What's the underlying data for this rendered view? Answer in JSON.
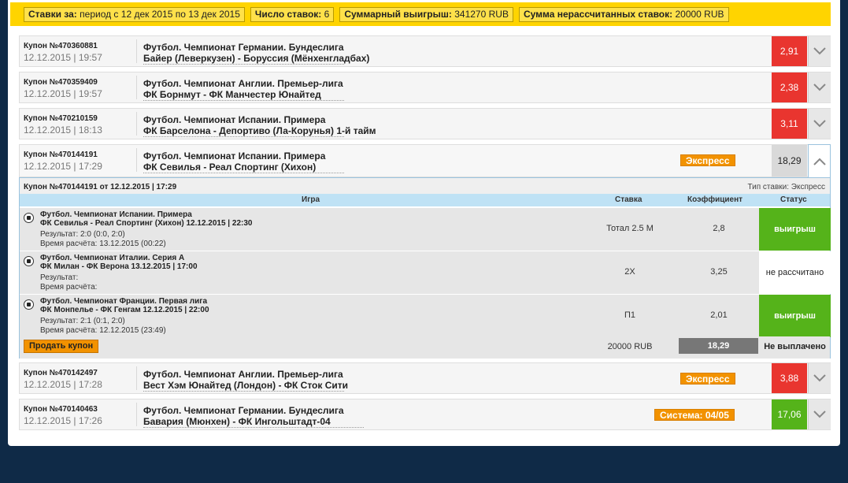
{
  "summary": {
    "period_label": "Ставки за:",
    "period_value": "период с 12 дек 2015 по 13 дек 2015",
    "count_label": "Число ставок:",
    "count_value": "6",
    "total_label": "Суммарный выигрыш:",
    "total_value": "341270 RUB",
    "pending_label": "Сумма нерассчитанных ставок:",
    "pending_value": "20000 RUB"
  },
  "coupons": [
    {
      "number": "Купон №470360881",
      "date": "12.12.2015 | 19:57",
      "league": "Футбол. Чемпионат Германии. Бундеслига",
      "match": "Байер (Леверкузен) - Боруссия (Мёнхенгладбах)",
      "odds": "2,91",
      "badge": ""
    },
    {
      "number": "Купон №470359409",
      "date": "12.12.2015 | 19:57",
      "league": "Футбол. Чемпионат Англии. Премьер-лига",
      "match": "ФК Борнмут - ФК Манчестер Юнайтед",
      "odds": "2,38",
      "badge": ""
    },
    {
      "number": "Купон №470210159",
      "date": "12.12.2015 | 18:13",
      "league": "Футбол. Чемпионат Испании. Примера",
      "match": "ФК Барселона - Депортиво (Ла-Корунья) 1-й тайм",
      "odds": "3,11",
      "badge": ""
    },
    {
      "number": "Купон №470144191",
      "date": "12.12.2015 | 17:29",
      "league": "Футбол. Чемпионат Испании. Примера",
      "match": "ФК Севилья - Реал Спортинг (Хихон)",
      "odds": "18,29",
      "badge": "Экспресс"
    },
    {
      "number": "Купон №470142497",
      "date": "12.12.2015 | 17:28",
      "league": "Футбол. Чемпионат Англии. Премьер-лига",
      "match": "Вест Хэм Юнайтед (Лондон) - ФК Сток Сити",
      "odds": "3,88",
      "badge": "Экспресс"
    },
    {
      "number": "Купон №470140463",
      "date": "12.12.2015 | 17:26",
      "league": "Футбол. Чемпионат Германии. Бундеслига",
      "match": "Бавария (Мюнхен) - ФК Ингольштадт-04",
      "odds": "17,06",
      "badge": "Система: 04/05"
    }
  ],
  "detail": {
    "title": "Купон №470144191 от 12.12.2015 | 17:29",
    "bet_type": "Тип ставки: Экспресс",
    "columns": {
      "game": "Игра",
      "stake": "Ставка",
      "coef": "Коэффициент",
      "status": "Статус"
    },
    "bets": [
      {
        "league": "Футбол. Чемпионат Испании. Примера",
        "match": "ФК Севилья - Реал Спортинг (Хихон) 12.12.2015 | 22:30",
        "result": "Результат: 2:0 (0:0, 2:0)",
        "calc_time": "Время расчёта: 13.12.2015 (00:22)",
        "stake": "Тотал 2.5 М",
        "coef": "2,8",
        "status": "выигрыш"
      },
      {
        "league": "Футбол. Чемпионат Италии. Серия А",
        "match": "ФК Милан - ФК Верона 13.12.2015 | 17:00",
        "result": "Результат:",
        "calc_time": "Время расчёта:",
        "stake": "2Х",
        "coef": "3,25",
        "status": "не рассчитано"
      },
      {
        "league": "Футбол. Чемпионат Франции. Первая лига",
        "match": "ФК Монпелье - ФК Генгам 12.12.2015 | 22:00",
        "result": "Результат: 2:1 (0:1, 2:0)",
        "calc_time": "Время расчёта: 12.12.2015 (23:49)",
        "stake": "П1",
        "coef": "2,01",
        "status": "выигрыш"
      }
    ],
    "footer": {
      "sell_label": "Продать купон",
      "stake": "20000 RUB",
      "coef": "18,29",
      "status": "Не выплачено"
    }
  },
  "colors": {
    "summary_bg": "#ffd400",
    "odds_red": "#e9352f",
    "odds_green": "#55b31a",
    "badge_orange": "#f29200",
    "page_bg": "#0f2a47"
  },
  "icons": {
    "expand": "chevron-down-icon",
    "collapse": "chevron-up-icon",
    "sport": "soccer-ball-icon"
  }
}
